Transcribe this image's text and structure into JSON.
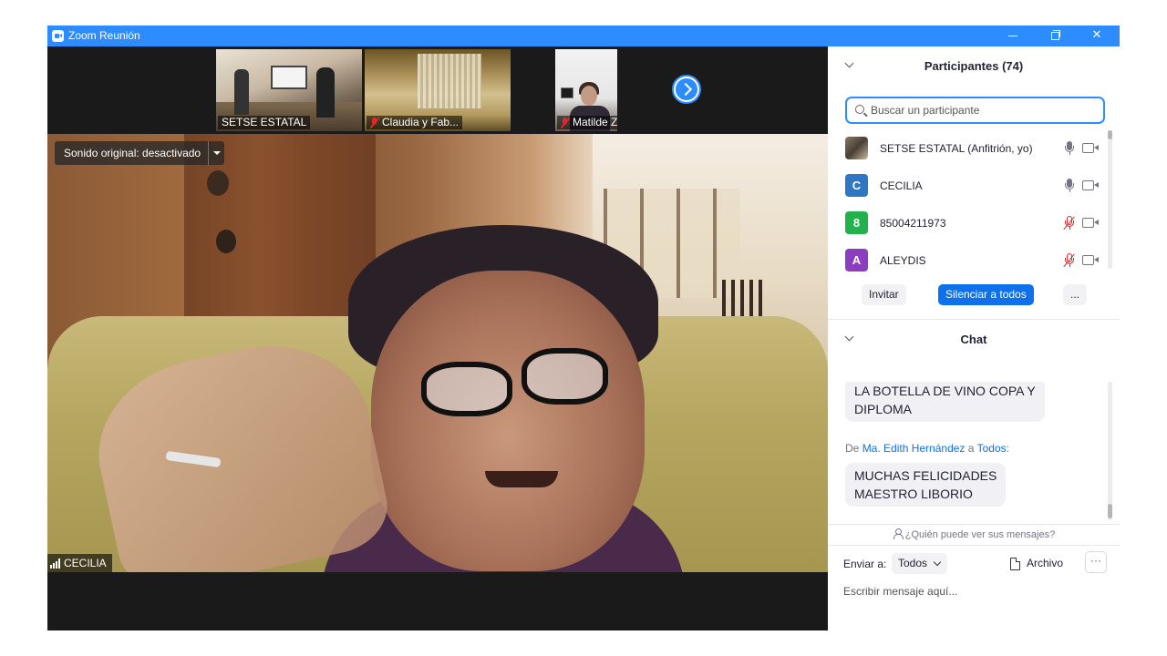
{
  "window": {
    "title": "Zoom Reunión"
  },
  "gallery": {
    "thumbnails": [
      {
        "name": "SETSE ESTATAL",
        "muted": false
      },
      {
        "name": "Claudia y Fab...",
        "muted": true
      },
      {
        "name": "Matilde Zam...",
        "muted": true
      }
    ]
  },
  "main_video": {
    "audio_label": "Sonido original: desactivado",
    "speaker_name": "CECILIA"
  },
  "participants": {
    "title": "Participantes (74)",
    "search_placeholder": "Buscar un participante",
    "items": [
      {
        "name": "SETSE ESTATAL (Anfitrión, yo)",
        "avatar_letter": "",
        "avatar_color": "#6b5c4c",
        "mic_muted": false,
        "avatar_icon": "photo"
      },
      {
        "name": "CECILIA",
        "avatar_letter": "C",
        "avatar_color": "#2f77c2",
        "mic_muted": false,
        "avatar_icon": "letter"
      },
      {
        "name": "85004211973",
        "avatar_letter": "8",
        "avatar_color": "#22b14c",
        "mic_muted": true,
        "avatar_icon": "letter"
      },
      {
        "name": "ALEYDIS",
        "avatar_letter": "A",
        "avatar_color": "#8b3fbf",
        "mic_muted": true,
        "avatar_icon": "letter"
      }
    ],
    "buttons": {
      "invite": "Invitar",
      "mute_all": "Silenciar a todos",
      "more": "..."
    }
  },
  "chat": {
    "title": "Chat",
    "messages": [
      {
        "text_line1": "LA BOTELLA DE VINO COPA Y",
        "text_line2": "DIPLOMA"
      },
      {
        "prefix": "De",
        "sender": "Ma. Edith Hernández",
        "connector": "a",
        "recipient": "Todos",
        "suffix": ":",
        "text_line1": "MUCHAS FELICIDADES",
        "text_line2": "MAESTRO LIBORIO"
      }
    ],
    "who_can_see": "¿Quién puede ver sus mensajes?",
    "send_to_label": "Enviar a:",
    "send_to_value": "Todos",
    "file_label": "Archivo",
    "more_label": "···",
    "compose_placeholder": "Escribir mensaje aquí..."
  },
  "colors": {
    "zoom_blue": "#2d8cff",
    "button_blue": "#0e71eb",
    "muted_red": "#e02828"
  }
}
